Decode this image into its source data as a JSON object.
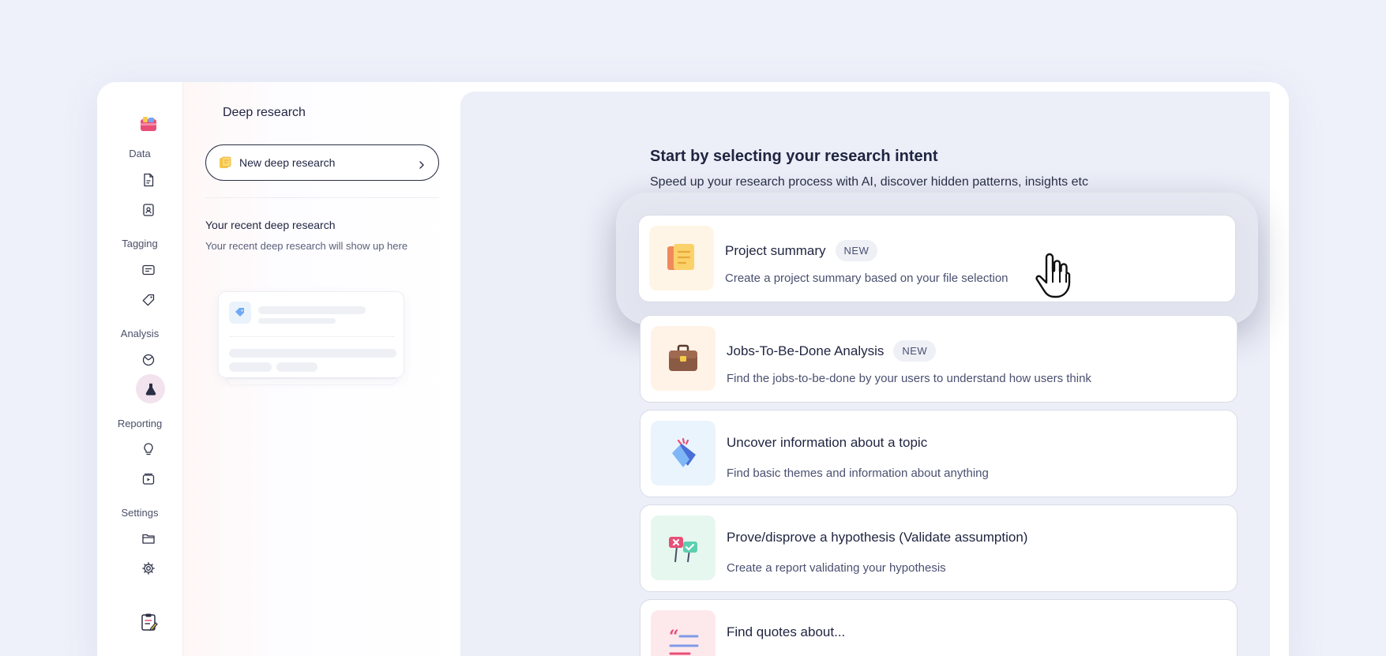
{
  "sidebar": {
    "sections": [
      {
        "label": "Data",
        "icons": [
          "document-icon",
          "contacts-icon"
        ]
      },
      {
        "label": "Tagging",
        "icons": [
          "text-block-icon",
          "tag-icon"
        ]
      },
      {
        "label": "Analysis",
        "icons": [
          "chart-pie-icon",
          "flask-icon"
        ]
      },
      {
        "label": "Reporting",
        "icons": [
          "lightbulb-icon",
          "video-icon"
        ]
      },
      {
        "label": "Settings",
        "icons": [
          "folder-icon",
          "gear-icon"
        ]
      }
    ],
    "active_icon": "flask-icon",
    "brand_color": "#e94e77"
  },
  "panel": {
    "title": "Deep research",
    "new_button_label": "New deep research",
    "recent_title": "Your recent deep research",
    "recent_empty": "Your recent deep research will show up here"
  },
  "main": {
    "title": "Start by selecting your research intent",
    "subtitle": "Speed up your research process with AI, discover hidden patterns, insights etc",
    "options": [
      {
        "title": "Project summary",
        "badge": "NEW",
        "description": "Create a project summary based on your file selection",
        "icon": "document-stack-icon",
        "thumb_bg": "#fff5e6",
        "highlighted": true
      },
      {
        "title": "Jobs-To-Be-Done Analysis",
        "badge": "NEW",
        "description": "Find the jobs-to-be-done by your users to understand how users think",
        "icon": "briefcase-icon",
        "thumb_bg": "#fff3e8",
        "highlighted": false
      },
      {
        "title": "Uncover information about a topic",
        "badge": "",
        "description": "Find basic themes and information about anything",
        "icon": "tag-search-icon",
        "thumb_bg": "#e9f4fd",
        "highlighted": false
      },
      {
        "title": "Prove/disprove a hypothesis (Validate assumption)",
        "badge": "",
        "description": "Create a report validating your hypothesis",
        "icon": "signs-icon",
        "thumb_bg": "#e6f7ef",
        "highlighted": false
      },
      {
        "title": "Find quotes about...",
        "badge": "",
        "description": "",
        "icon": "quote-icon",
        "thumb_bg": "#fde9ec",
        "highlighted": false
      }
    ]
  }
}
